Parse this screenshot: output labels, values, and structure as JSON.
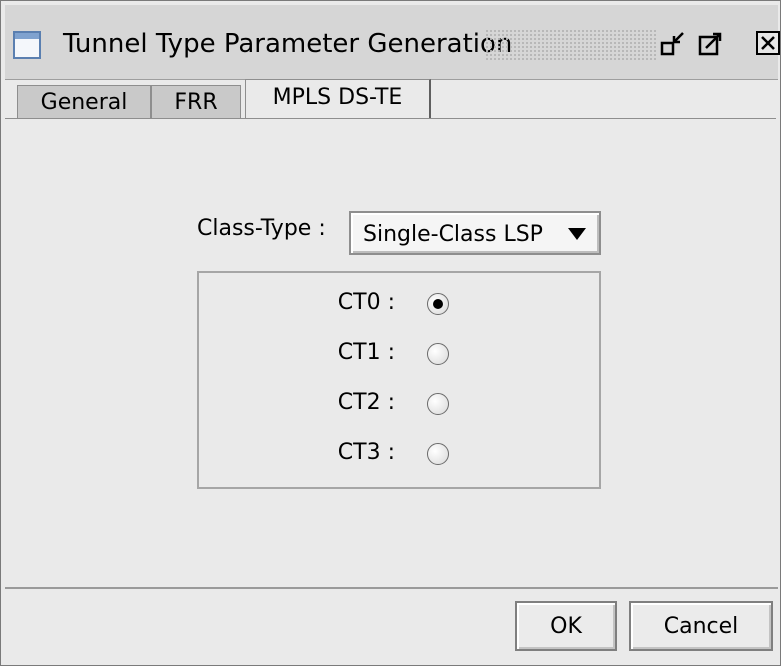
{
  "window": {
    "title": "Tunnel Type Parameter Generation",
    "icons": [
      "window-icon",
      "minimize-icon",
      "maximize-icon",
      "close-icon"
    ]
  },
  "tabs": [
    {
      "label": "General",
      "active": false
    },
    {
      "label": "FRR",
      "active": false
    },
    {
      "label": "MPLS DS-TE",
      "active": true
    }
  ],
  "mpls_ds_te": {
    "class_type_label": "Class-Type :",
    "class_type_value": "Single-Class LSP",
    "ct_options": [
      {
        "label": "CT0 :",
        "selected": true
      },
      {
        "label": "CT1 :",
        "selected": false
      },
      {
        "label": "CT2 :",
        "selected": false
      },
      {
        "label": "CT3 :",
        "selected": false
      }
    ]
  },
  "footer": {
    "ok_label": "OK",
    "cancel_label": "Cancel"
  }
}
